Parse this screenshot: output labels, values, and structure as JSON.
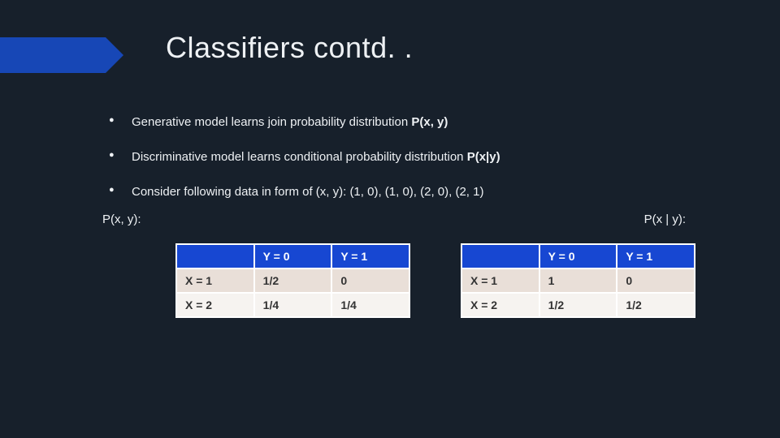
{
  "title": "Classifiers contd. .",
  "bullets": [
    {
      "prefix": "Generative model learns join probability distribution ",
      "bold": "P(x, y)"
    },
    {
      "prefix": "Discriminative model learns conditional probability distribution ",
      "bold": "P(x|y)"
    },
    {
      "prefix": "Consider following data in form of (x, y):   (1, 0), (1, 0), (2, 0), (2, 1)",
      "bold": ""
    }
  ],
  "labels": {
    "left": "P(x, y):",
    "right": "P(x | y):"
  },
  "table_left": {
    "headers": [
      "",
      "Y = 0",
      "Y = 1"
    ],
    "rows": [
      [
        "X = 1",
        "1/2",
        "0"
      ],
      [
        "X = 2",
        "1/4",
        "1/4"
      ]
    ]
  },
  "table_right": {
    "headers": [
      "",
      "Y = 0",
      "Y = 1"
    ],
    "rows": [
      [
        "X = 1",
        "1",
        "0"
      ],
      [
        "X = 2",
        "1/2",
        "1/2"
      ]
    ]
  }
}
